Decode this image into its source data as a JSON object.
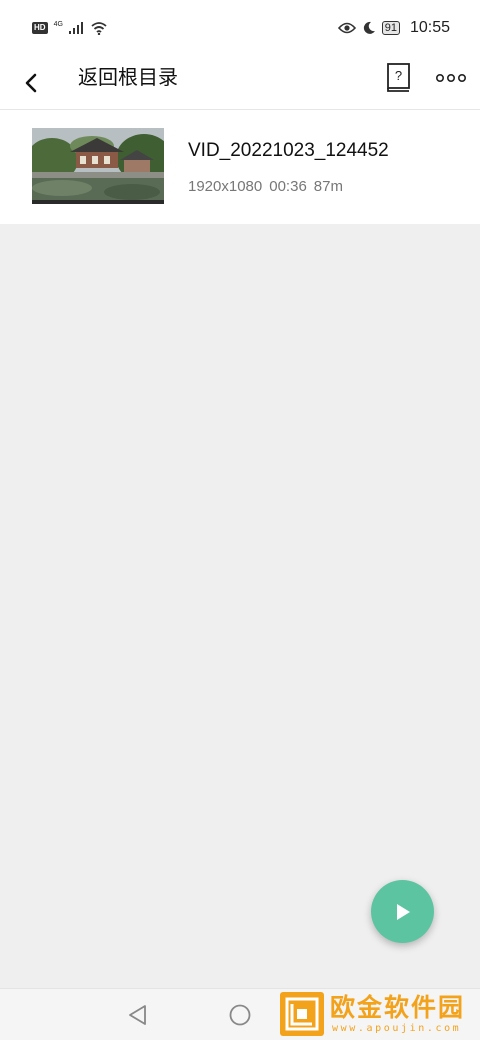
{
  "status_bar": {
    "hd": "HD",
    "network": "4G",
    "battery": "91",
    "time": "10:55",
    "icons": [
      "signal-icon",
      "wifi-icon",
      "eye-comfort-icon",
      "do-not-disturb-moon-icon",
      "battery-icon"
    ]
  },
  "app_bar": {
    "title": "返回根目录",
    "back_icon": "chevron-left-icon",
    "help_icon": "help-book-icon",
    "help_glyph": "?",
    "more_icon": "more-dots-icon"
  },
  "videos": [
    {
      "name": "VID_20221023_124452",
      "resolution": "1920x1080",
      "duration": "00:36",
      "size": "87m"
    }
  ],
  "fab": {
    "icon": "play-icon",
    "color": "#5dc4a1"
  },
  "nav_bar": {
    "icons": [
      "triangle-back-icon",
      "circle-home-icon"
    ]
  },
  "watermark": {
    "text": "欧金软件园",
    "url": "www.apoujin.com",
    "color": "#f3a21c"
  }
}
